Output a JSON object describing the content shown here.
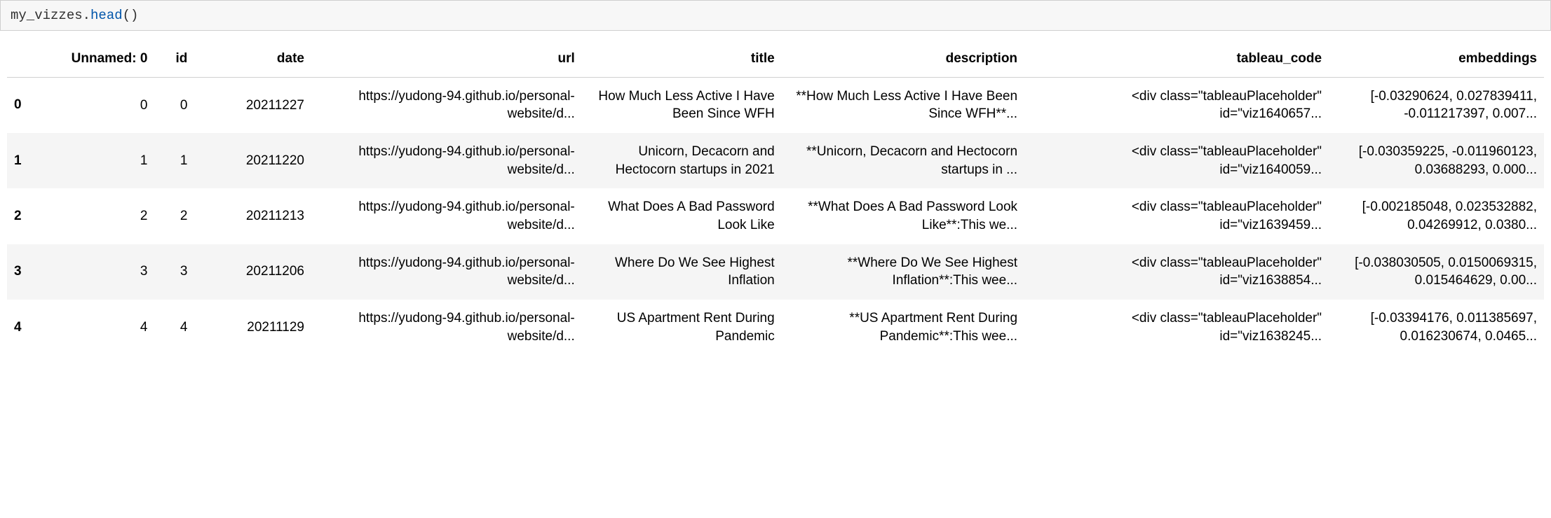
{
  "code": {
    "object": "my_vizzes",
    "dot": ".",
    "method": "head",
    "parens": "()"
  },
  "columns": {
    "unnamed": "Unnamed: 0",
    "id": "id",
    "date": "date",
    "url": "url",
    "title": "title",
    "description": "description",
    "tableau_code": "tableau_code",
    "embeddings": "embeddings"
  },
  "rows": [
    {
      "idx": "0",
      "unnamed": "0",
      "id": "0",
      "date": "20211227",
      "url": "https://yudong-94.github.io/personal-website/d...",
      "title": "How Much Less Active I Have Been Since WFH",
      "description": "**How Much Less Active I Have Been Since WFH**...",
      "tableau_code": "<div class=\"tableauPlaceholder\" id=\"viz1640657...",
      "embeddings": "[-0.03290624, 0.027839411, -0.011217397, 0.007..."
    },
    {
      "idx": "1",
      "unnamed": "1",
      "id": "1",
      "date": "20211220",
      "url": "https://yudong-94.github.io/personal-website/d...",
      "title": "Unicorn, Decacorn and Hectocorn startups in 2021",
      "description": "**Unicorn, Decacorn and Hectocorn startups in ...",
      "tableau_code": "<div class=\"tableauPlaceholder\" id=\"viz1640059...",
      "embeddings": "[-0.030359225, -0.011960123, 0.03688293, 0.000..."
    },
    {
      "idx": "2",
      "unnamed": "2",
      "id": "2",
      "date": "20211213",
      "url": "https://yudong-94.github.io/personal-website/d...",
      "title": "What Does A Bad Password Look Like",
      "description": "**What Does A Bad Password Look Like**:This we...",
      "tableau_code": "<div class=\"tableauPlaceholder\" id=\"viz1639459...",
      "embeddings": "[-0.002185048, 0.023532882, 0.04269912, 0.0380..."
    },
    {
      "idx": "3",
      "unnamed": "3",
      "id": "3",
      "date": "20211206",
      "url": "https://yudong-94.github.io/personal-website/d...",
      "title": "Where Do We See Highest Inflation",
      "description": "**Where Do We See Highest Inflation**:This wee...",
      "tableau_code": "<div class=\"tableauPlaceholder\" id=\"viz1638854...",
      "embeddings": "[-0.038030505, 0.0150069315, 0.015464629, 0.00..."
    },
    {
      "idx": "4",
      "unnamed": "4",
      "id": "4",
      "date": "20211129",
      "url": "https://yudong-94.github.io/personal-website/d...",
      "title": "US Apartment Rent During Pandemic",
      "description": "**US Apartment Rent During Pandemic**:This wee...",
      "tableau_code": "<div class=\"tableauPlaceholder\" id=\"viz1638245...",
      "embeddings": "[-0.03394176, 0.011385697, 0.016230674, 0.0465..."
    }
  ]
}
